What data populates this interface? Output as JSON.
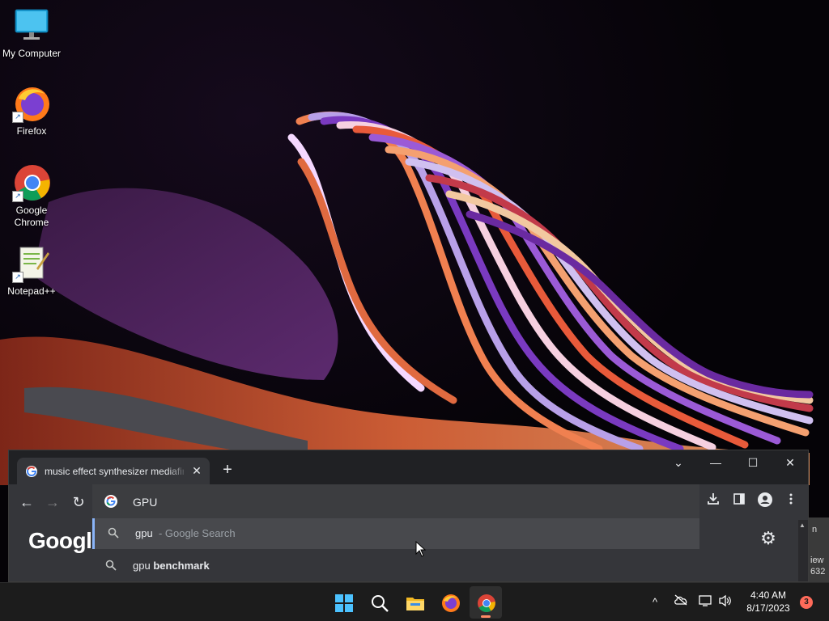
{
  "desktop": {
    "icons": [
      {
        "label": "My Computer",
        "icon": "monitor-icon"
      },
      {
        "label": "Firefox",
        "icon": "firefox-icon"
      },
      {
        "label": "Google Chrome",
        "icon": "chrome-icon"
      },
      {
        "label": "Notepad++",
        "icon": "notepad-plus-plus-icon"
      }
    ]
  },
  "browser": {
    "tab": {
      "title": "music effect synthesizer mediafire",
      "close": "✕"
    },
    "new_tab_label": "+",
    "window_controls": {
      "tab_search": "⌄",
      "minimize": "—",
      "maximize": "☐",
      "close": "✕"
    },
    "nav": {
      "back": "←",
      "forward": "→",
      "reload": "↻"
    },
    "omnibox": {
      "value": "GPU"
    },
    "toolbar_icons": [
      "download-icon",
      "side-panel-icon",
      "profile-icon",
      "menu-icon"
    ],
    "suggestions": [
      {
        "query": "gpu",
        "suffix": "- Google Search",
        "selected": true
      },
      {
        "query": "gpu",
        "completion": " benchmark",
        "selected": false
      }
    ],
    "page": {
      "logo_text": "Google",
      "settings_icon": "gear-icon"
    }
  },
  "peek_window": {
    "line1": "n",
    "line2": "iew",
    "line3": "632"
  },
  "taskbar": {
    "apps": [
      {
        "name": "start",
        "icon": "windows-start-icon"
      },
      {
        "name": "search",
        "icon": "search-icon"
      },
      {
        "name": "file-explorer",
        "icon": "folder-icon"
      },
      {
        "name": "firefox",
        "icon": "firefox-icon"
      },
      {
        "name": "chrome",
        "icon": "chrome-icon",
        "active": true
      }
    ],
    "tray": {
      "overflow": "^",
      "time": "4:40 AM",
      "date": "8/17/2023",
      "notifications": "3"
    }
  },
  "colors": {
    "chrome_dark": "#202124",
    "toolbar": "#35363a",
    "accent": "#8ab4f8",
    "taskbar": "#1c1c1c"
  }
}
